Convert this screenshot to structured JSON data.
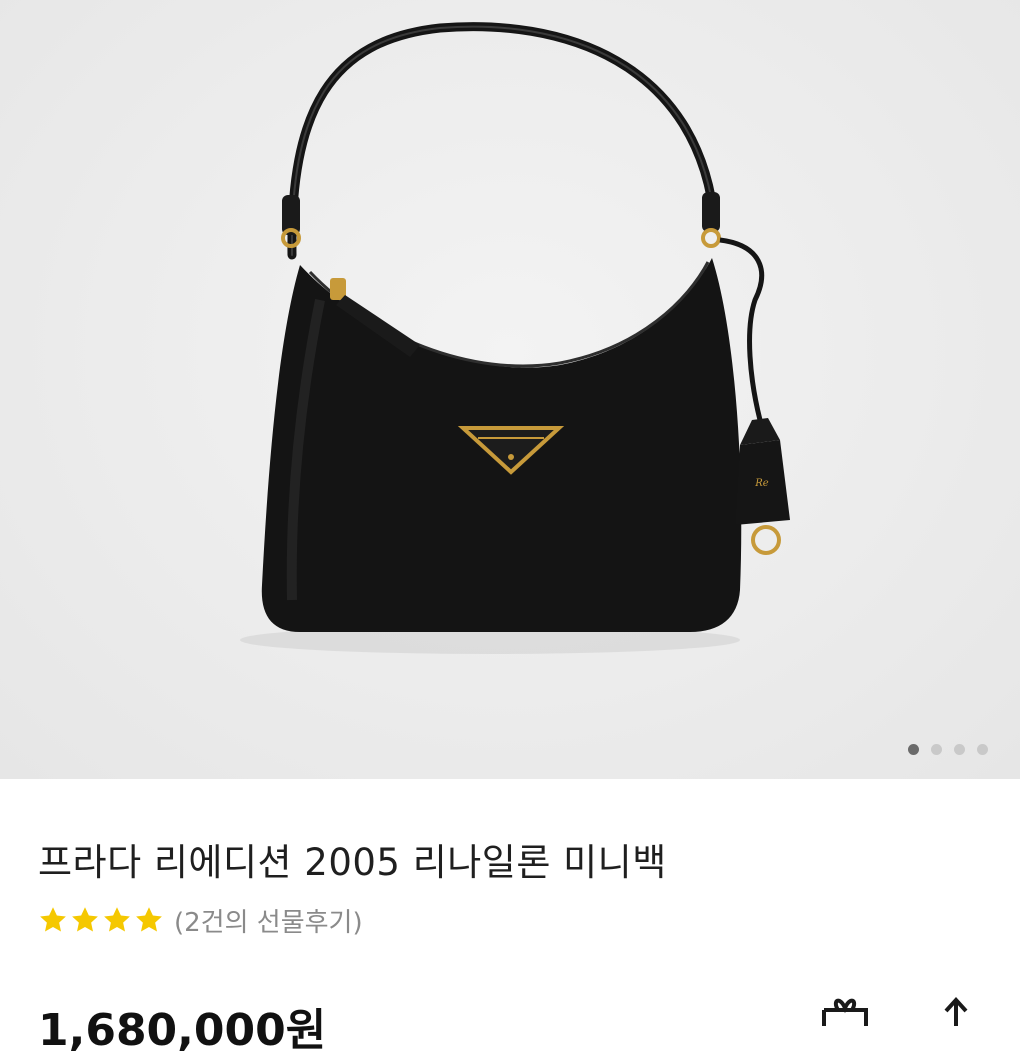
{
  "carousel": {
    "image_alt": "Prada Re-Edition 2005 nylon mini bag",
    "slide_count": 4,
    "active_slide": 1
  },
  "product": {
    "title": "프라다 리에디션 2005 리나일론 미니백",
    "rating_stars": 4,
    "review_text": "(2건의 선물후기)",
    "price": "1,680,000원"
  },
  "icons": {
    "star": "star-icon",
    "gift": "gift-icon",
    "share": "share-icon"
  },
  "colors": {
    "star": "#f5c800",
    "bag": "#141414",
    "hardware": "#c79a3a"
  }
}
